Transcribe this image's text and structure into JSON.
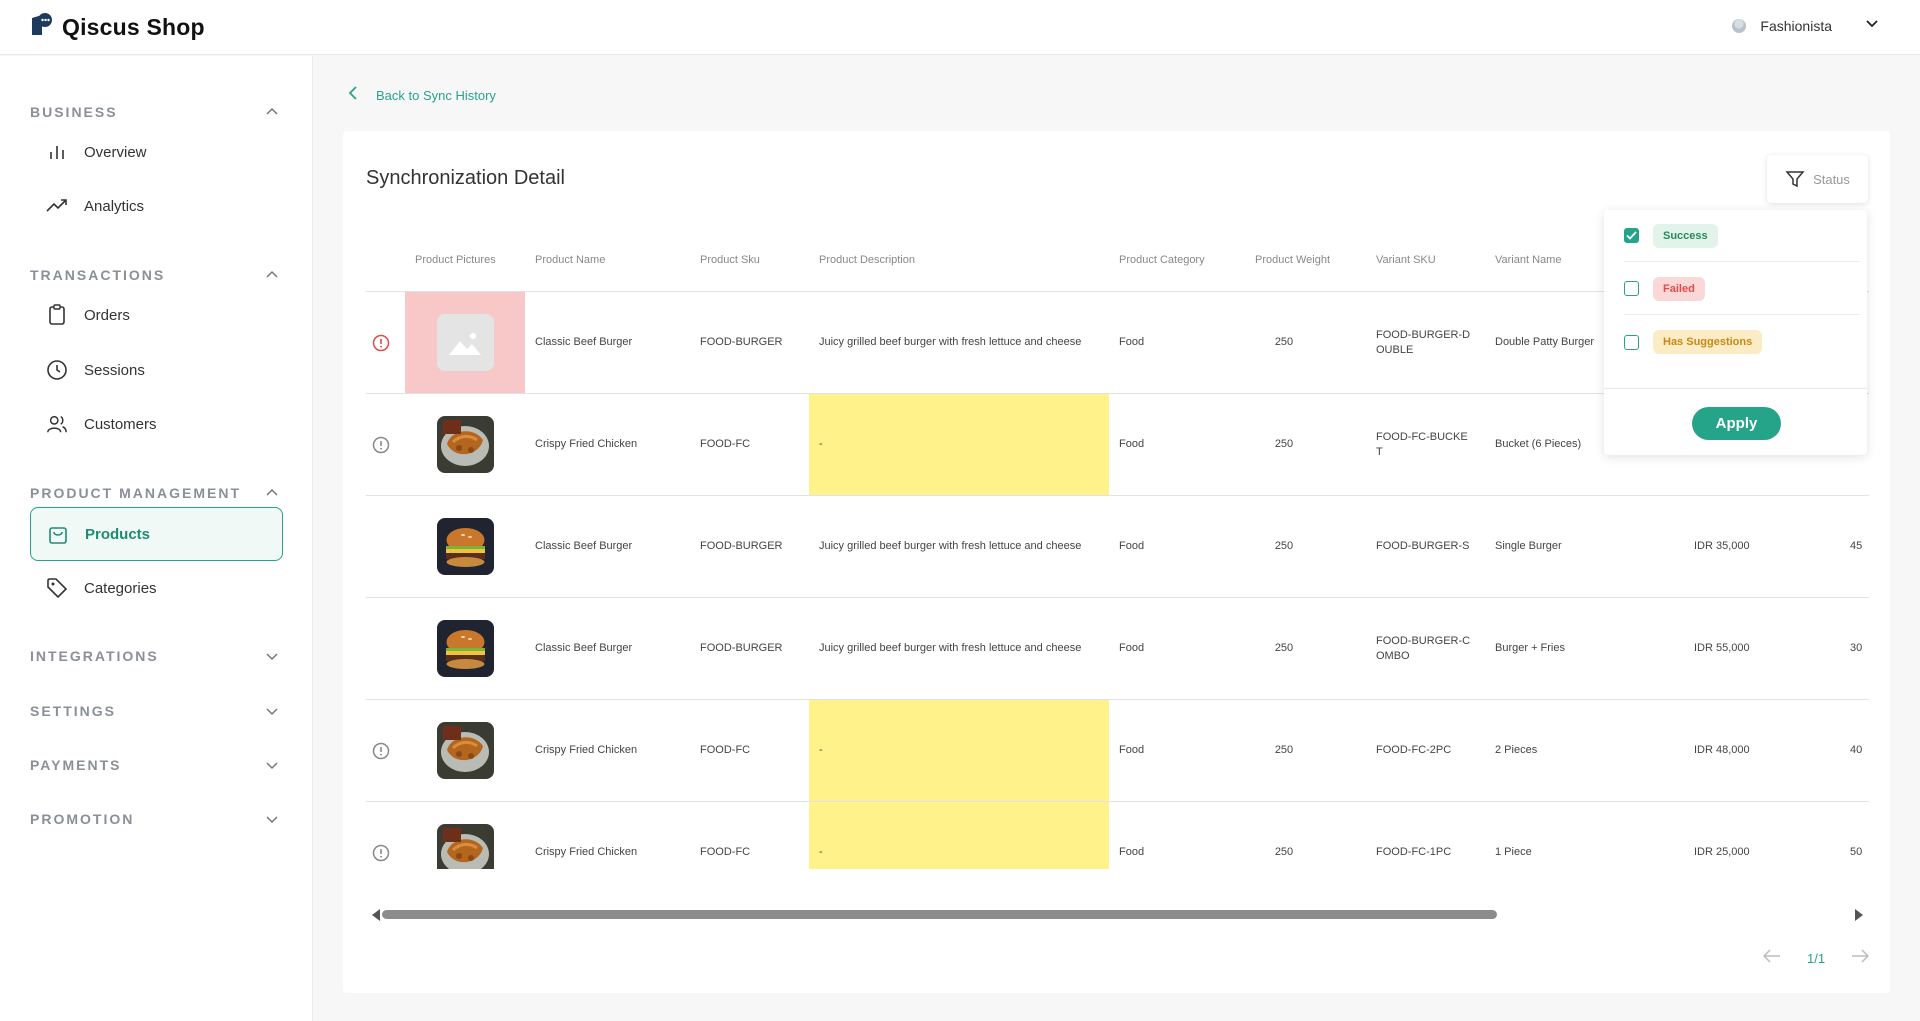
{
  "app": {
    "name": "Qiscus Shop"
  },
  "user": {
    "name": "Fashionista"
  },
  "sidebar": {
    "sections": [
      {
        "label": "BUSINESS",
        "expanded": true,
        "items": [
          {
            "label": "Overview",
            "icon": "bar-chart-icon"
          },
          {
            "label": "Analytics",
            "icon": "trend-icon"
          }
        ]
      },
      {
        "label": "TRANSACTIONS",
        "expanded": true,
        "items": [
          {
            "label": "Orders",
            "icon": "clipboard-icon"
          },
          {
            "label": "Sessions",
            "icon": "clock-icon"
          },
          {
            "label": "Customers",
            "icon": "users-icon"
          }
        ]
      },
      {
        "label": "PRODUCT MANAGEMENT",
        "expanded": true,
        "items": [
          {
            "label": "Products",
            "icon": "bag-icon",
            "active": true
          },
          {
            "label": "Categories",
            "icon": "tag-icon"
          }
        ]
      },
      {
        "label": "INTEGRATIONS",
        "expanded": false,
        "items": []
      },
      {
        "label": "SETTINGS",
        "expanded": false,
        "items": []
      },
      {
        "label": "PAYMENTS",
        "expanded": false,
        "items": []
      },
      {
        "label": "PROMOTION",
        "expanded": false,
        "items": []
      }
    ]
  },
  "main": {
    "back_label": "Back to Sync History",
    "title": "Synchronization Detail",
    "status_filter_label": "Status"
  },
  "table": {
    "columns": [
      "Product Pictures",
      "Product Name",
      "Product Sku",
      "Product Description",
      "Product Category",
      "Product Weight",
      "Variant SKU",
      "Variant Name",
      "",
      ""
    ],
    "rows": [
      {
        "status": "error",
        "picture": "placeholder",
        "name": "Classic Beef Burger",
        "sku": "FOOD-BURGER",
        "description": "Juicy grilled beef burger with fresh lettuce and cheese",
        "category": "Food",
        "weight": "250",
        "variant_sku": "FOOD-BURGER-D OUBLE",
        "variant_name": "Double Patty Burger",
        "price": "",
        "stock": "",
        "highlight": "picture"
      },
      {
        "status": "warning",
        "picture": "chicken",
        "name": "Crispy Fried Chicken",
        "sku": "FOOD-FC",
        "description": "-",
        "category": "Food",
        "weight": "250",
        "variant_sku": "FOOD-FC-BUCKE T",
        "variant_name": "Bucket (6 Pieces)",
        "price": "",
        "stock": "",
        "highlight": "description"
      },
      {
        "status": "none",
        "picture": "burger",
        "name": "Classic Beef Burger",
        "sku": "FOOD-BURGER",
        "description": "Juicy grilled beef burger with fresh lettuce and cheese",
        "category": "Food",
        "weight": "250",
        "variant_sku": "FOOD-BURGER-S",
        "variant_name": "Single Burger",
        "price": "IDR 35,000",
        "stock": "45",
        "highlight": ""
      },
      {
        "status": "none",
        "picture": "burger",
        "name": "Classic Beef Burger",
        "sku": "FOOD-BURGER",
        "description": "Juicy grilled beef burger with fresh lettuce and cheese",
        "category": "Food",
        "weight": "250",
        "variant_sku": "FOOD-BURGER-C OMBO",
        "variant_name": "Burger + Fries",
        "price": "IDR 55,000",
        "stock": "30",
        "highlight": ""
      },
      {
        "status": "warning",
        "picture": "chicken",
        "name": "Crispy Fried Chicken",
        "sku": "FOOD-FC",
        "description": "-",
        "category": "Food",
        "weight": "250",
        "variant_sku": "FOOD-FC-2PC",
        "variant_name": "2 Pieces",
        "price": "IDR 48,000",
        "stock": "40",
        "highlight": "description"
      },
      {
        "status": "warning",
        "picture": "chicken",
        "name": "Crispy Fried Chicken",
        "sku": "FOOD-FC",
        "description": "-",
        "category": "Food",
        "weight": "250",
        "variant_sku": "FOOD-FC-1PC",
        "variant_name": "1 Piece",
        "price": "IDR 25,000",
        "stock": "50",
        "highlight": "description"
      }
    ]
  },
  "pagination": {
    "label": "1/1"
  },
  "filter": {
    "options": [
      {
        "label": "Success",
        "checked": true,
        "style": "success"
      },
      {
        "label": "Failed",
        "checked": false,
        "style": "failed"
      },
      {
        "label": "Has Suggestions",
        "checked": false,
        "style": "sugg"
      }
    ],
    "apply_label": "Apply"
  },
  "colors": {
    "accent": "#26a48a",
    "error": "#e24b4b",
    "highlight_red": "#f8c8c8",
    "highlight_yellow": "#fff28a"
  }
}
